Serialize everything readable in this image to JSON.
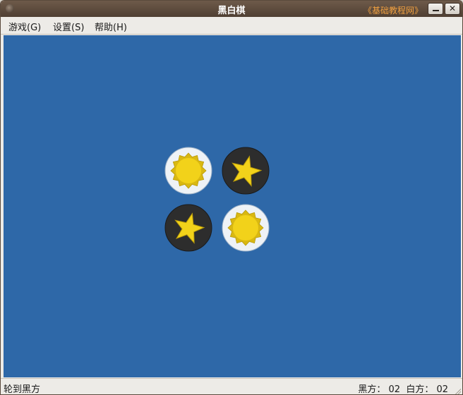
{
  "window": {
    "title": "黑白棋",
    "watermark": "《基础教程网》",
    "minimize_label": "",
    "close_label": "✕"
  },
  "menu": {
    "game": "游戏(G)",
    "settings": "设置(S)",
    "help": "帮助(H)"
  },
  "board": {
    "background_color": "#2e68a8",
    "pieces": [
      {
        "row": 0,
        "col": 0,
        "color": "white",
        "icon": "sun-icon"
      },
      {
        "row": 0,
        "col": 1,
        "color": "black",
        "icon": "star-icon"
      },
      {
        "row": 1,
        "col": 0,
        "color": "black",
        "icon": "star-icon"
      },
      {
        "row": 1,
        "col": 1,
        "color": "white",
        "icon": "sun-icon"
      }
    ]
  },
  "status": {
    "turn": "轮到黑方",
    "score": "黑方： 02  白方： 02"
  },
  "colors": {
    "white_piece": "#eef2f6",
    "black_piece": "#2d2d2d",
    "emblem_yellow": "#f2d21a"
  }
}
